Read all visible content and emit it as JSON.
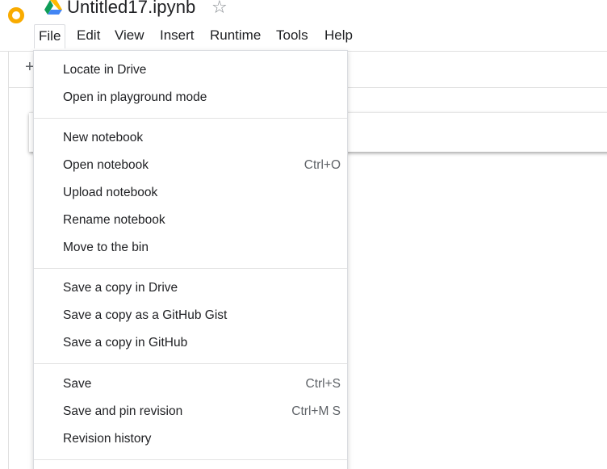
{
  "app": {
    "notebook_title": "Untitled17.ipynb",
    "colors": {
      "logo_orange": "#F9AB00",
      "text": "#202124",
      "muted": "#5f6368",
      "border": "#dadce0"
    }
  },
  "header": {
    "logo_icon": "colab-logo",
    "drive_icon": "google-drive-icon",
    "star_icon": "star-outline-icon",
    "star_glyph": "☆"
  },
  "menubar": {
    "items": [
      {
        "label": "File",
        "active": true
      },
      {
        "label": "Edit"
      },
      {
        "label": "View"
      },
      {
        "label": "Insert"
      },
      {
        "label": "Runtime"
      },
      {
        "label": "Tools"
      },
      {
        "label": "Help"
      }
    ]
  },
  "toolbar": {
    "add_glyph": "+"
  },
  "file_menu": {
    "items": [
      {
        "label": "Locate in Drive",
        "shortcut": ""
      },
      {
        "label": "Open in playground mode",
        "shortcut": ""
      },
      {
        "label": "New notebook",
        "shortcut": ""
      },
      {
        "label": "Open notebook",
        "shortcut": "Ctrl+O"
      },
      {
        "label": "Upload notebook",
        "shortcut": ""
      },
      {
        "label": "Rename notebook",
        "shortcut": ""
      },
      {
        "label": "Move to the bin",
        "shortcut": ""
      },
      {
        "label": "Save a copy in Drive",
        "shortcut": ""
      },
      {
        "label": "Save a copy as a GitHub Gist",
        "shortcut": ""
      },
      {
        "label": "Save a copy in GitHub",
        "shortcut": ""
      },
      {
        "label": "Save",
        "shortcut": "Ctrl+S"
      },
      {
        "label": "Save and pin revision",
        "shortcut": "Ctrl+M S"
      },
      {
        "label": "Revision history",
        "shortcut": ""
      }
    ]
  }
}
